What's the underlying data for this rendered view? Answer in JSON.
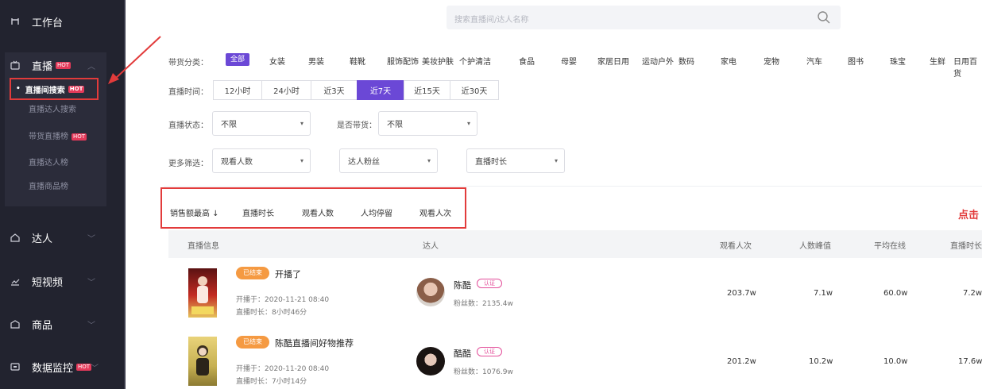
{
  "sidebar": {
    "workbench": "工作台",
    "live": {
      "label": "直播",
      "badge": "HOT"
    },
    "live_sub": [
      {
        "label": "直播间搜索",
        "badge": "HOT"
      },
      {
        "label": "直播达人搜索",
        "badge": ""
      },
      {
        "label": "带货直播榜",
        "badge": "HOT"
      },
      {
        "label": "直播达人榜",
        "badge": ""
      },
      {
        "label": "直播商品榜",
        "badge": ""
      }
    ],
    "items": [
      {
        "label": "达人"
      },
      {
        "label": "短视频"
      },
      {
        "label": "商品"
      },
      {
        "label": "数据监控",
        "badge": "HOT"
      }
    ]
  },
  "search": {
    "placeholder": "搜索直播间/达人名称"
  },
  "filters": {
    "category_label": "带货分类：",
    "categories": [
      "全部",
      "女装",
      "男装",
      "鞋靴",
      "服饰配饰",
      "美妆护肤",
      "个护清洁",
      "食品",
      "母婴",
      "家居日用",
      "运动户外",
      "数码",
      "家电",
      "宠物",
      "汽车",
      "图书",
      "珠宝",
      "生鲜",
      "日用百货"
    ],
    "time_label": "直播时间：",
    "time_options": [
      "12小时",
      "24小时",
      "近3天",
      "近7天",
      "近15天",
      "近30天"
    ],
    "time_active_index": 3,
    "live_status_label": "直播状态：",
    "live_status_value": "不限",
    "goods_label": "是否带货：",
    "goods_value": "不限",
    "more_label": "更多筛选：",
    "more_selects": [
      "观看人数",
      "达人粉丝",
      "直播时长"
    ]
  },
  "sort": {
    "options": [
      "销售额最高 ↓",
      "直播时长",
      "观看人数",
      "人均停留",
      "观看人次"
    ],
    "hint": "点击"
  },
  "table": {
    "headers": [
      "直播信息",
      "达人",
      "观看人次",
      "人数峰值",
      "平均在线",
      "直播时长"
    ],
    "rows": [
      {
        "tag": "已结束",
        "title": "开播了",
        "start": "开播于：2020-11-21 08:40",
        "duration": "直播时长：8小时46分",
        "anchor": "陈酷",
        "anchor_badge": "认证",
        "fans": "粉丝数：2135.4w",
        "viewers": "203.7w",
        "peak": "7.1w",
        "avg": "60.0w",
        "time": "7.2w"
      },
      {
        "tag": "已结束",
        "title": "陈酷直播间好物推荐",
        "start": "开播于：2020-11-20 08:40",
        "duration": "直播时长：7小时14分",
        "anchor": "酷酷",
        "anchor_badge": "认证",
        "fans": "粉丝数：1076.9w",
        "viewers": "201.2w",
        "peak": "10.2w",
        "avg": "10.0w",
        "time": "17.6w"
      }
    ]
  }
}
